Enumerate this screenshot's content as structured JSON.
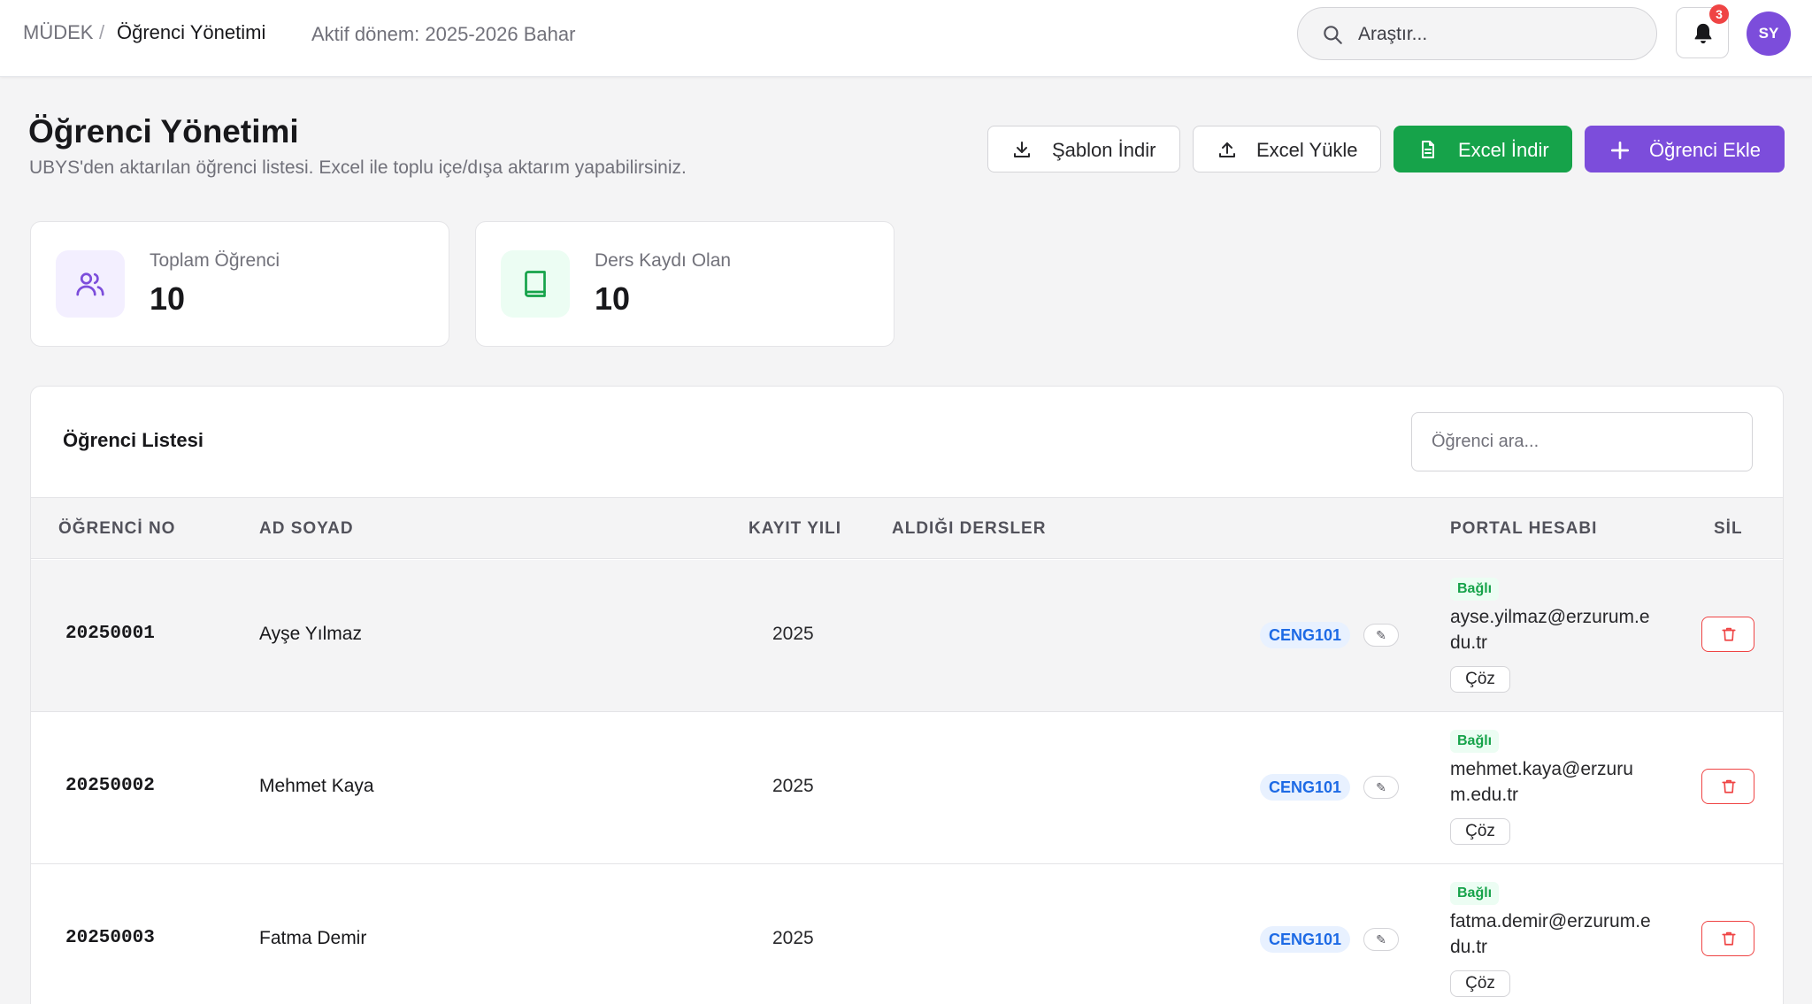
{
  "topbar": {
    "breadcrumb_root": "MÜDEK",
    "breadcrumb_sep": "/",
    "breadcrumb_current": "Öğrenci Yönetimi",
    "active_term": "Aktif dönem: 2025-2026 Bahar",
    "search_placeholder": "Araştır...",
    "notification_count": "3",
    "avatar_initials": "SY"
  },
  "header": {
    "title": "Öğrenci Yönetimi",
    "subtitle": "UBYS'den aktarılan öğrenci listesi. Excel ile toplu içe/dışa aktarım yapabilirsiniz.",
    "buttons": {
      "template": "Şablon İndir",
      "upload": "Excel Yükle",
      "download": "Excel İndir",
      "add": "Öğrenci Ekle"
    }
  },
  "stats": [
    {
      "label": "Toplam Öğrenci",
      "value": "10",
      "icon": "users-icon"
    },
    {
      "label": "Ders Kaydı Olan",
      "value": "10",
      "icon": "book-icon"
    }
  ],
  "list": {
    "title": "Öğrenci Listesi",
    "search_placeholder": "Öğrenci ara...",
    "columns": [
      "ÖĞRENCİ NO",
      "AD SOYAD",
      "KAYIT YILI",
      "ALDIĞI DERSLER",
      "PORTAL HESABI",
      "SİL"
    ],
    "rows": [
      {
        "no": "20250001",
        "name": "Ayşe Yılmaz",
        "year": "2025",
        "course": "CENG101",
        "edit": "✎",
        "status": "Bağlı",
        "email": "ayse.yilmaz@erzurum.edu.tr",
        "action": "Çöz"
      },
      {
        "no": "20250002",
        "name": "Mehmet Kaya",
        "year": "2025",
        "course": "CENG101",
        "edit": "✎",
        "status": "Bağlı",
        "email": "mehmet.kaya@erzurum.edu.tr",
        "action": "Çöz"
      },
      {
        "no": "20250003",
        "name": "Fatma Demir",
        "year": "2025",
        "course": "CENG101",
        "edit": "✎",
        "status": "Bağlı",
        "email": "fatma.demir@erzurum.edu.tr",
        "action": "Çöz"
      }
    ]
  },
  "colors": {
    "accent": "#7c4ddb",
    "success": "#16a34a",
    "danger": "#ef4444",
    "course_badge": "#1d6ae5"
  }
}
